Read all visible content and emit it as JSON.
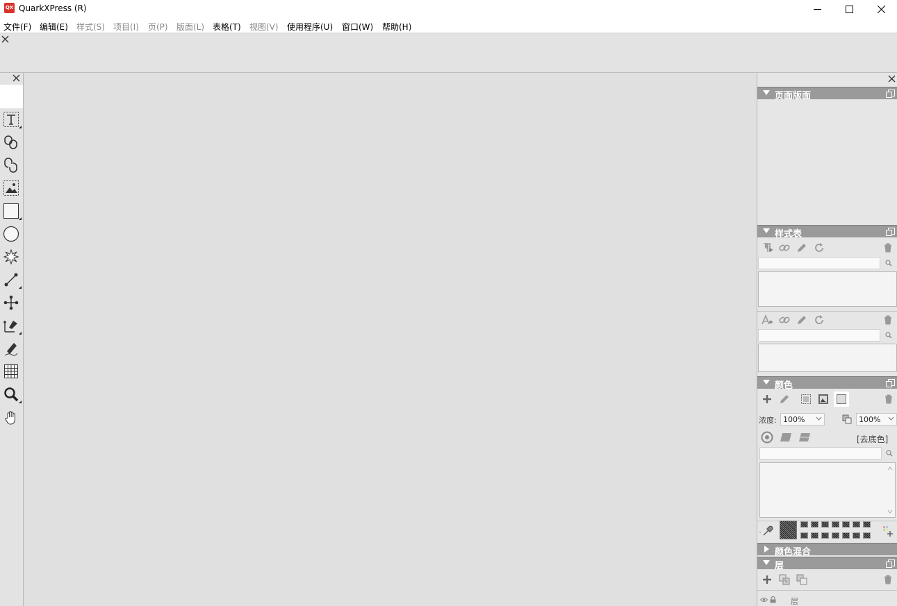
{
  "window": {
    "app_icon_text": "QX",
    "title": "QuarkXPress (R)"
  },
  "menu": [
    {
      "label": "文件(F)",
      "enabled": true
    },
    {
      "label": "编辑(E)",
      "enabled": true
    },
    {
      "label": "样式(S)",
      "enabled": false
    },
    {
      "label": "项目(I)",
      "enabled": false
    },
    {
      "label": "页(P)",
      "enabled": false
    },
    {
      "label": "版面(L)",
      "enabled": false
    },
    {
      "label": "表格(T)",
      "enabled": true
    },
    {
      "label": "视图(V)",
      "enabled": false
    },
    {
      "label": "使用程序(U)",
      "enabled": true
    },
    {
      "label": "窗口(W)",
      "enabled": true
    },
    {
      "label": "帮助(H)",
      "enabled": true
    }
  ],
  "tools": [
    {
      "icon": "text-content-tool-icon"
    },
    {
      "icon": "linking-tool-icon"
    },
    {
      "icon": "unlinking-tool-icon"
    },
    {
      "icon": "picture-content-tool-icon"
    },
    {
      "icon": "rectangle-box-tool-icon"
    },
    {
      "icon": "oval-box-tool-icon"
    },
    {
      "icon": "starburst-tool-icon"
    },
    {
      "icon": "line-tool-icon"
    },
    {
      "icon": "scissors-point-tool-icon"
    },
    {
      "icon": "bezier-pen-tool-icon"
    },
    {
      "icon": "freehand-pencil-tool-icon"
    },
    {
      "icon": "table-tool-icon"
    },
    {
      "icon": "zoom-tool-icon"
    },
    {
      "icon": "pan-hand-tool-icon"
    }
  ],
  "panels": {
    "page_layout": {
      "title": "页面版面"
    },
    "style_sheets": {
      "title": "样式表"
    },
    "colors": {
      "title": "颜色",
      "tint_label": "浓度:",
      "tint_value": "100%",
      "opacity_value": "100%",
      "remove_label": "[去底色]"
    },
    "blends": {
      "title": "颜色混合"
    },
    "layers": {
      "title": "层",
      "column_label": "层"
    }
  }
}
